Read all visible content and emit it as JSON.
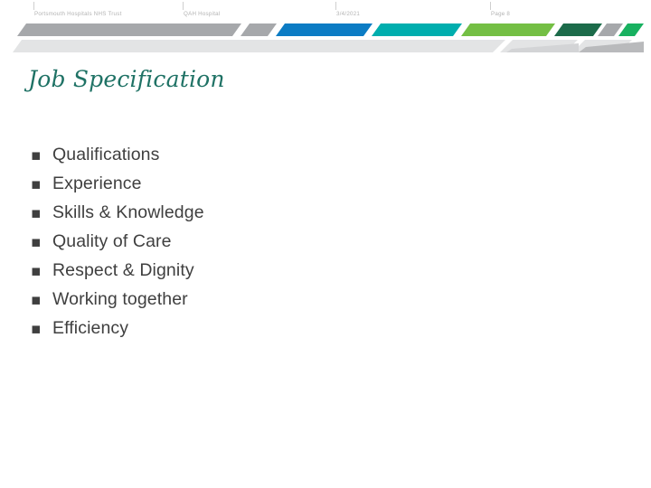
{
  "slide": {
    "title": "Job Specification",
    "title_color": "#1f7265",
    "background_color": "#ffffff",
    "page_number_label": "Page 8"
  },
  "header": {
    "trust_name": "Portsmouth Hospitals NHS Trust",
    "site_name": "QAH Hospital",
    "date": "3/4/2021",
    "page": "Page 8",
    "text_color": "#b3b3b3"
  },
  "decor_bar": {
    "colors": {
      "gray_dark": "#a6a8ab",
      "gray_light": "#d9dadb",
      "gray_pale": "#e3e4e5",
      "blue": "#0c7cc4",
      "teal": "#00aeae",
      "green": "#74bf44",
      "green_dark": "#1c6b4a",
      "green_bright": "#18b160"
    },
    "segment_order": [
      "gray_dark",
      "gray_dark",
      "blue",
      "teal",
      "green",
      "green_dark",
      "gray_dark",
      "green_bright"
    ]
  },
  "bullets": {
    "marker": "▪",
    "text_color": "#3f3f3f",
    "items": [
      {
        "label": "Qualifications"
      },
      {
        "label": "Experience"
      },
      {
        "label": "Skills & Knowledge"
      },
      {
        "label": "Quality of Care"
      },
      {
        "label": "Respect & Dignity"
      },
      {
        "label": "Working together"
      },
      {
        "label": "Efficiency"
      }
    ]
  }
}
